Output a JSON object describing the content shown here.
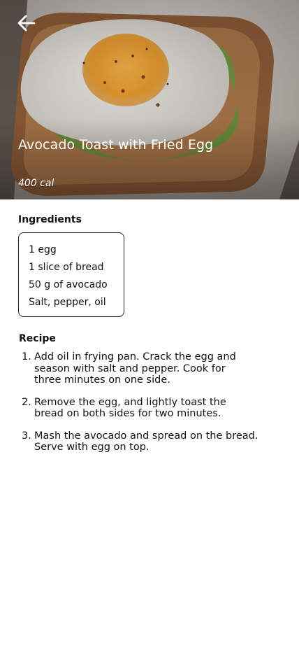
{
  "header": {
    "back_icon": "arrow-left-icon",
    "title": "Avocado Toast with Fried Egg",
    "calories": "400 cal"
  },
  "ingredients": {
    "heading": "Ingredients",
    "items": [
      "1 egg",
      "1 slice of bread",
      "50 g of avocado",
      "Salt, pepper, oil"
    ]
  },
  "recipe": {
    "heading": "Recipe",
    "steps": [
      {
        "number": "1.",
        "lines": [
          "Add oil in frying pan. Crack the egg and",
          "season with salt and pepper. Cook for",
          "three minutes on one side."
        ]
      },
      {
        "number": "2.",
        "lines": [
          "Remove the egg, and lightly toast the",
          "bread on both sides for two minutes."
        ]
      },
      {
        "number": "3.",
        "lines": [
          "Mash the avocado and spread on the bread.",
          "Serve with egg on top."
        ]
      }
    ]
  },
  "colors": {
    "text": "#111111",
    "overlay_text": "#ffffff",
    "border": "#222222"
  }
}
